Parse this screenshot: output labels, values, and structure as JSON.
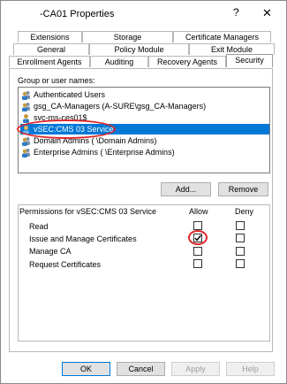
{
  "window": {
    "title": "-CA01 Properties",
    "help_label": "?",
    "close_label": "✕"
  },
  "tabs": {
    "row1": [
      "Extensions",
      "Storage",
      "Certificate Managers"
    ],
    "row2": [
      "General",
      "Policy Module",
      "Exit Module"
    ],
    "row3": [
      "Enrollment Agents",
      "Auditing",
      "Recovery Agents",
      "Security"
    ],
    "active": "Security"
  },
  "security": {
    "group_label": "Group or user names:",
    "users": [
      {
        "name": "Authenticated Users",
        "icon": "users-icon",
        "selected": false
      },
      {
        "name": "gsg_CA-Managers (A-SURE\\gsg_CA-Managers)",
        "icon": "users-icon",
        "selected": false
      },
      {
        "name": "svc-ms-ces01$",
        "icon": "user-icon",
        "selected": false
      },
      {
        "name": "vSEC:CMS 03 Service",
        "icon": "user-icon",
        "selected": true
      },
      {
        "name": "Domain Admins (             \\Domain Admins)",
        "icon": "users-icon",
        "selected": false
      },
      {
        "name": "Enterprise Admins (            \\Enterprise Admins)",
        "icon": "users-icon",
        "selected": false
      }
    ],
    "add_label": "Add...",
    "remove_label": "Remove",
    "permissions_label": "Permissions for vSEC:CMS 03 Service",
    "allow_header": "Allow",
    "deny_header": "Deny",
    "permissions": [
      {
        "name": "Read",
        "allow": false,
        "deny": false
      },
      {
        "name": "Issue and Manage Certificates",
        "allow": true,
        "deny": false
      },
      {
        "name": "Manage CA",
        "allow": false,
        "deny": false
      },
      {
        "name": "Request Certificates",
        "allow": false,
        "deny": false
      }
    ]
  },
  "footer": {
    "ok_label": "OK",
    "cancel_label": "Cancel",
    "apply_label": "Apply",
    "help_label": "Help"
  },
  "colors": {
    "selection": "#0078d7",
    "highlight_ring": "#e0262a"
  }
}
